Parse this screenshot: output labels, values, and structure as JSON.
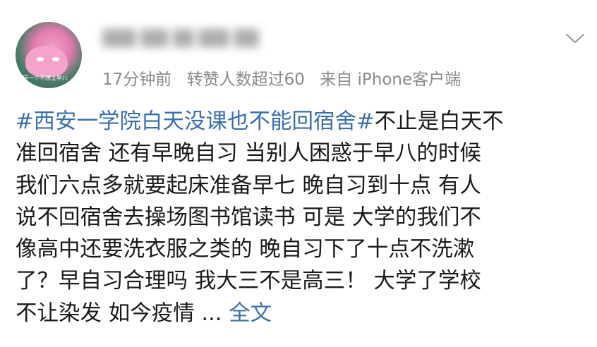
{
  "avatar": {
    "caption": "是一个不想上早八"
  },
  "meta": {
    "time": "17分钟前",
    "reposts": "转赞人数超过60",
    "source": "来自 iPhone客户端"
  },
  "post": {
    "hashtag": "#西安一学院白天没课也不能回宿舍#",
    "line1_rest": "不止是白天不",
    "lines": [
      "准回宿舍 还有早晚自习 当别人困惑于早八的时候",
      "我们六点多就要起床准备早七 晚自习到十点 有人",
      "说不回宿舍去操场图书馆读书 可是 大学的我们不",
      "像高中还要洗衣服之类的 晚自习下了十点不洗漱",
      "了？早自习合理吗 我大三不是高三！ 大学了学校"
    ],
    "last_line": "不让染发 如今疫情 ...",
    "more_label": "全文"
  },
  "icons": {
    "menu": "chevron-down-icon"
  },
  "colors": {
    "link": "#3a6fb0",
    "meta": "#8a8a8a",
    "text": "#1a1a1a"
  }
}
